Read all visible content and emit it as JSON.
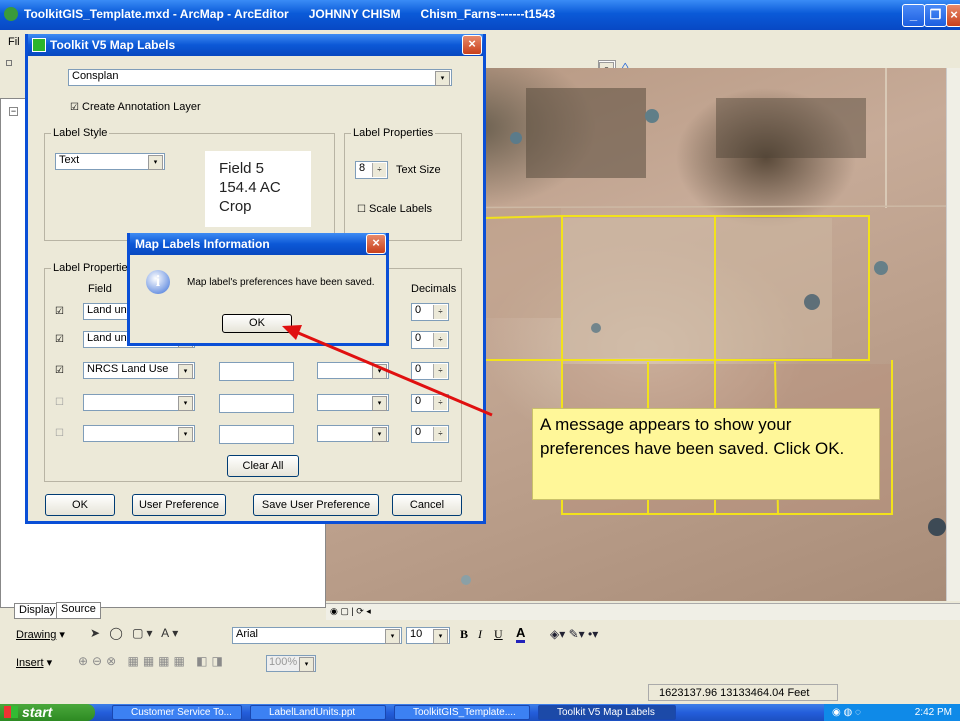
{
  "app": {
    "title": "ToolkitGIS_Template.mxd - ArcMap - ArcEditor",
    "user": "JOHNNY CHISM",
    "doc": "Chism_Farns-------t1543",
    "menu_frag": "Fil"
  },
  "toolbar": {
    "combo_arrow": "▾",
    "status_coords": "1623137.96  13133464.04 Feet",
    "drawing_label": "Drawing",
    "insert_label": "Insert",
    "font_name": "Arial",
    "font_size": "10",
    "zoom_value": "100%",
    "bold": "B",
    "italic": "I",
    "underline": "U",
    "font_color": "A"
  },
  "toc": {
    "tab_display": "Display",
    "tab_source": "Source"
  },
  "labels_dialog": {
    "title": "Toolkit V5 Map Labels",
    "layer": "Consplan",
    "create_annotation": "Create Annotation Layer",
    "label_style_group": "Label Style",
    "style_value": "Text",
    "preview_lines": [
      "Field 5",
      "154.4 AC",
      "Crop"
    ],
    "label_props_group": "Label Properties",
    "text_size": "8",
    "text_size_label": "Text Size",
    "scale_labels": "Scale Labels",
    "label_props_group2": "Label Properties",
    "field_header": "Field",
    "decimals_header": "Decimals",
    "rows": [
      {
        "checked": true,
        "field": "Land uni",
        "decimals": "0"
      },
      {
        "checked": true,
        "field": "Land uni",
        "decimals": "0"
      },
      {
        "checked": true,
        "field": "NRCS Land Use",
        "decimals": "0"
      },
      {
        "checked": false,
        "field": "",
        "decimals": "0"
      },
      {
        "checked": false,
        "field": "",
        "decimals": "0"
      }
    ],
    "clear_all": "Clear All",
    "ok": "OK",
    "user_pref": "User Preference",
    "save_pref": "Save User Preference",
    "cancel": "Cancel"
  },
  "info_dialog": {
    "title": "Map Labels Information",
    "message": "Map label's preferences have been saved.",
    "ok": "OK",
    "icon_glyph": "i"
  },
  "callout": {
    "text": "A message appears to show your preferences have been saved. Click OK."
  },
  "taskbar": {
    "start": "start",
    "tasks": [
      "Customer Service To...",
      "LabelLandUnits.ppt",
      "ToolkitGIS_Template....",
      "Toolkit V5 Map Labels"
    ],
    "clock": "2:42 PM"
  },
  "colors": {
    "parcel_lines": "#f2e21b",
    "arrow": "#e01010",
    "xp_blue": "#0a5ad8"
  }
}
